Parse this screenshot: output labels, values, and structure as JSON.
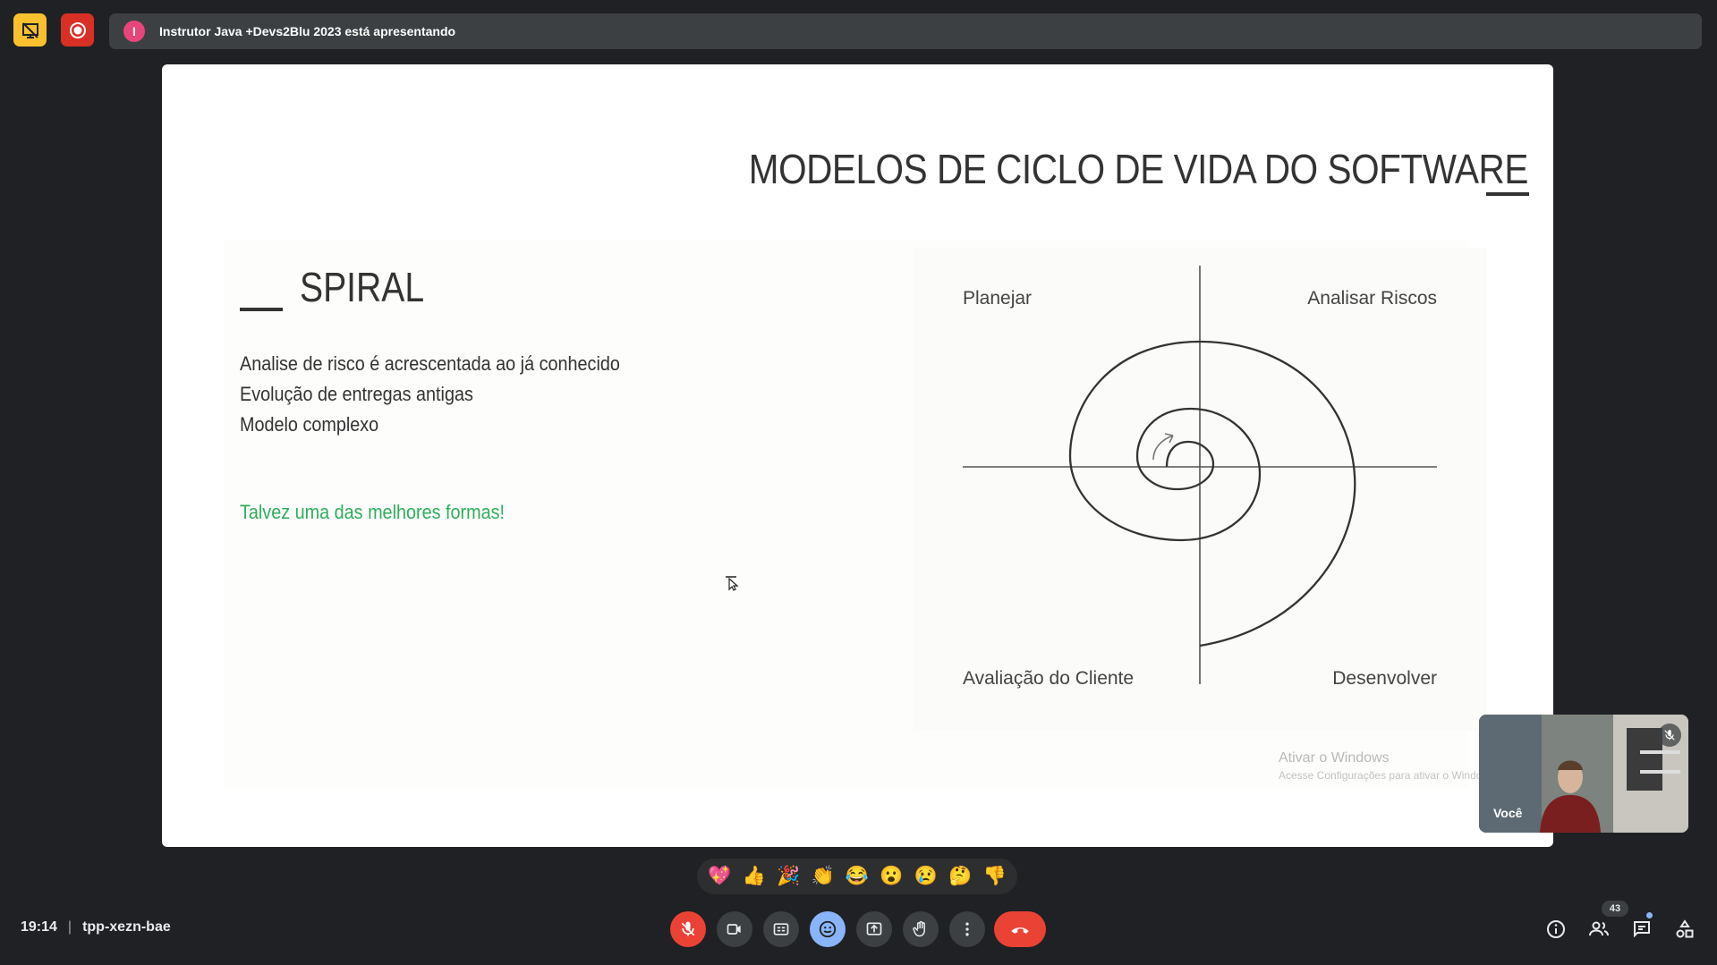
{
  "top_bar": {
    "presenter_text": "Instrutor Java +Devs2Blu 2023 está apresentando",
    "presenter_initial": "I",
    "colors": {
      "present_icon_bg": "#f9c12e",
      "record_icon_bg": "#d93025",
      "avatar_bg": "#e8457a"
    }
  },
  "slide": {
    "title": "MODELOS DE CICLO DE VIDA DO SOFTWARE",
    "section": "SPIRAL",
    "bullets": [
      "Analise de risco é acrescentada ao já conhecido",
      "Evolução de entregas antigas",
      "Modelo complexo"
    ],
    "highlight": "Talvez uma das melhores formas!",
    "highlight_color": "#2fae5a",
    "diagram": {
      "top_left": "Planejar",
      "top_right": "Analisar Riscos",
      "bottom_left": "Avaliação do Cliente",
      "bottom_right": "Desenvolver"
    },
    "watermark": {
      "line1": "Ativar o Windows",
      "line2": "Acesse Configurações para ativar o Windows."
    }
  },
  "self_view": {
    "label": "Você",
    "mic_icon": "mic-off-icon"
  },
  "reactions": [
    "💖",
    "👍",
    "🎉",
    "👏",
    "😂",
    "😮",
    "😢",
    "🤔",
    "👎"
  ],
  "bottom_bar": {
    "time": "19:14",
    "separator": "|",
    "meeting_code": "tpp-xezn-bae",
    "participant_count": "43",
    "controls": [
      "mic-off-icon",
      "camera-icon",
      "captions-icon",
      "emoji-icon",
      "present-icon",
      "raise-hand-icon",
      "more-icon",
      "end-call-icon"
    ],
    "right_controls": [
      "info-icon",
      "people-icon",
      "chat-icon",
      "activities-icon"
    ]
  }
}
